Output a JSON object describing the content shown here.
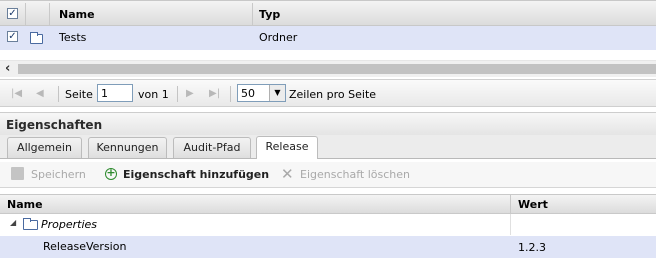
{
  "grid": {
    "columns": [
      "Name",
      "Typ"
    ],
    "rows": [
      {
        "name": "Tests",
        "type": "Ordner",
        "checked": true
      }
    ]
  },
  "pager": {
    "page_label": "Seite",
    "page_value": "1",
    "of_label": "von 1",
    "page_size": "50",
    "rows_label": "Zeilen pro Seite"
  },
  "properties": {
    "title": "Eigenschaften",
    "tabs": [
      "Allgemein",
      "Kennungen",
      "Audit-Pfad",
      "Release"
    ],
    "active_tab": "Release",
    "toolbar": {
      "save": "Speichern",
      "add": "Eigenschaft hinzufügen",
      "delete": "Eigenschaft löschen"
    },
    "columns": [
      "Name",
      "Wert"
    ],
    "group_label": "Properties",
    "rows": [
      {
        "name": "ReleaseVersion",
        "value": "1.2.3"
      }
    ]
  },
  "icons": {
    "folder": "folder-icon",
    "add": "plus-circle-icon",
    "delete": "x-icon",
    "save": "floppy-icon"
  },
  "colors": {
    "selection": "#dfe4f7",
    "add_icon": "#2e8b2e"
  }
}
